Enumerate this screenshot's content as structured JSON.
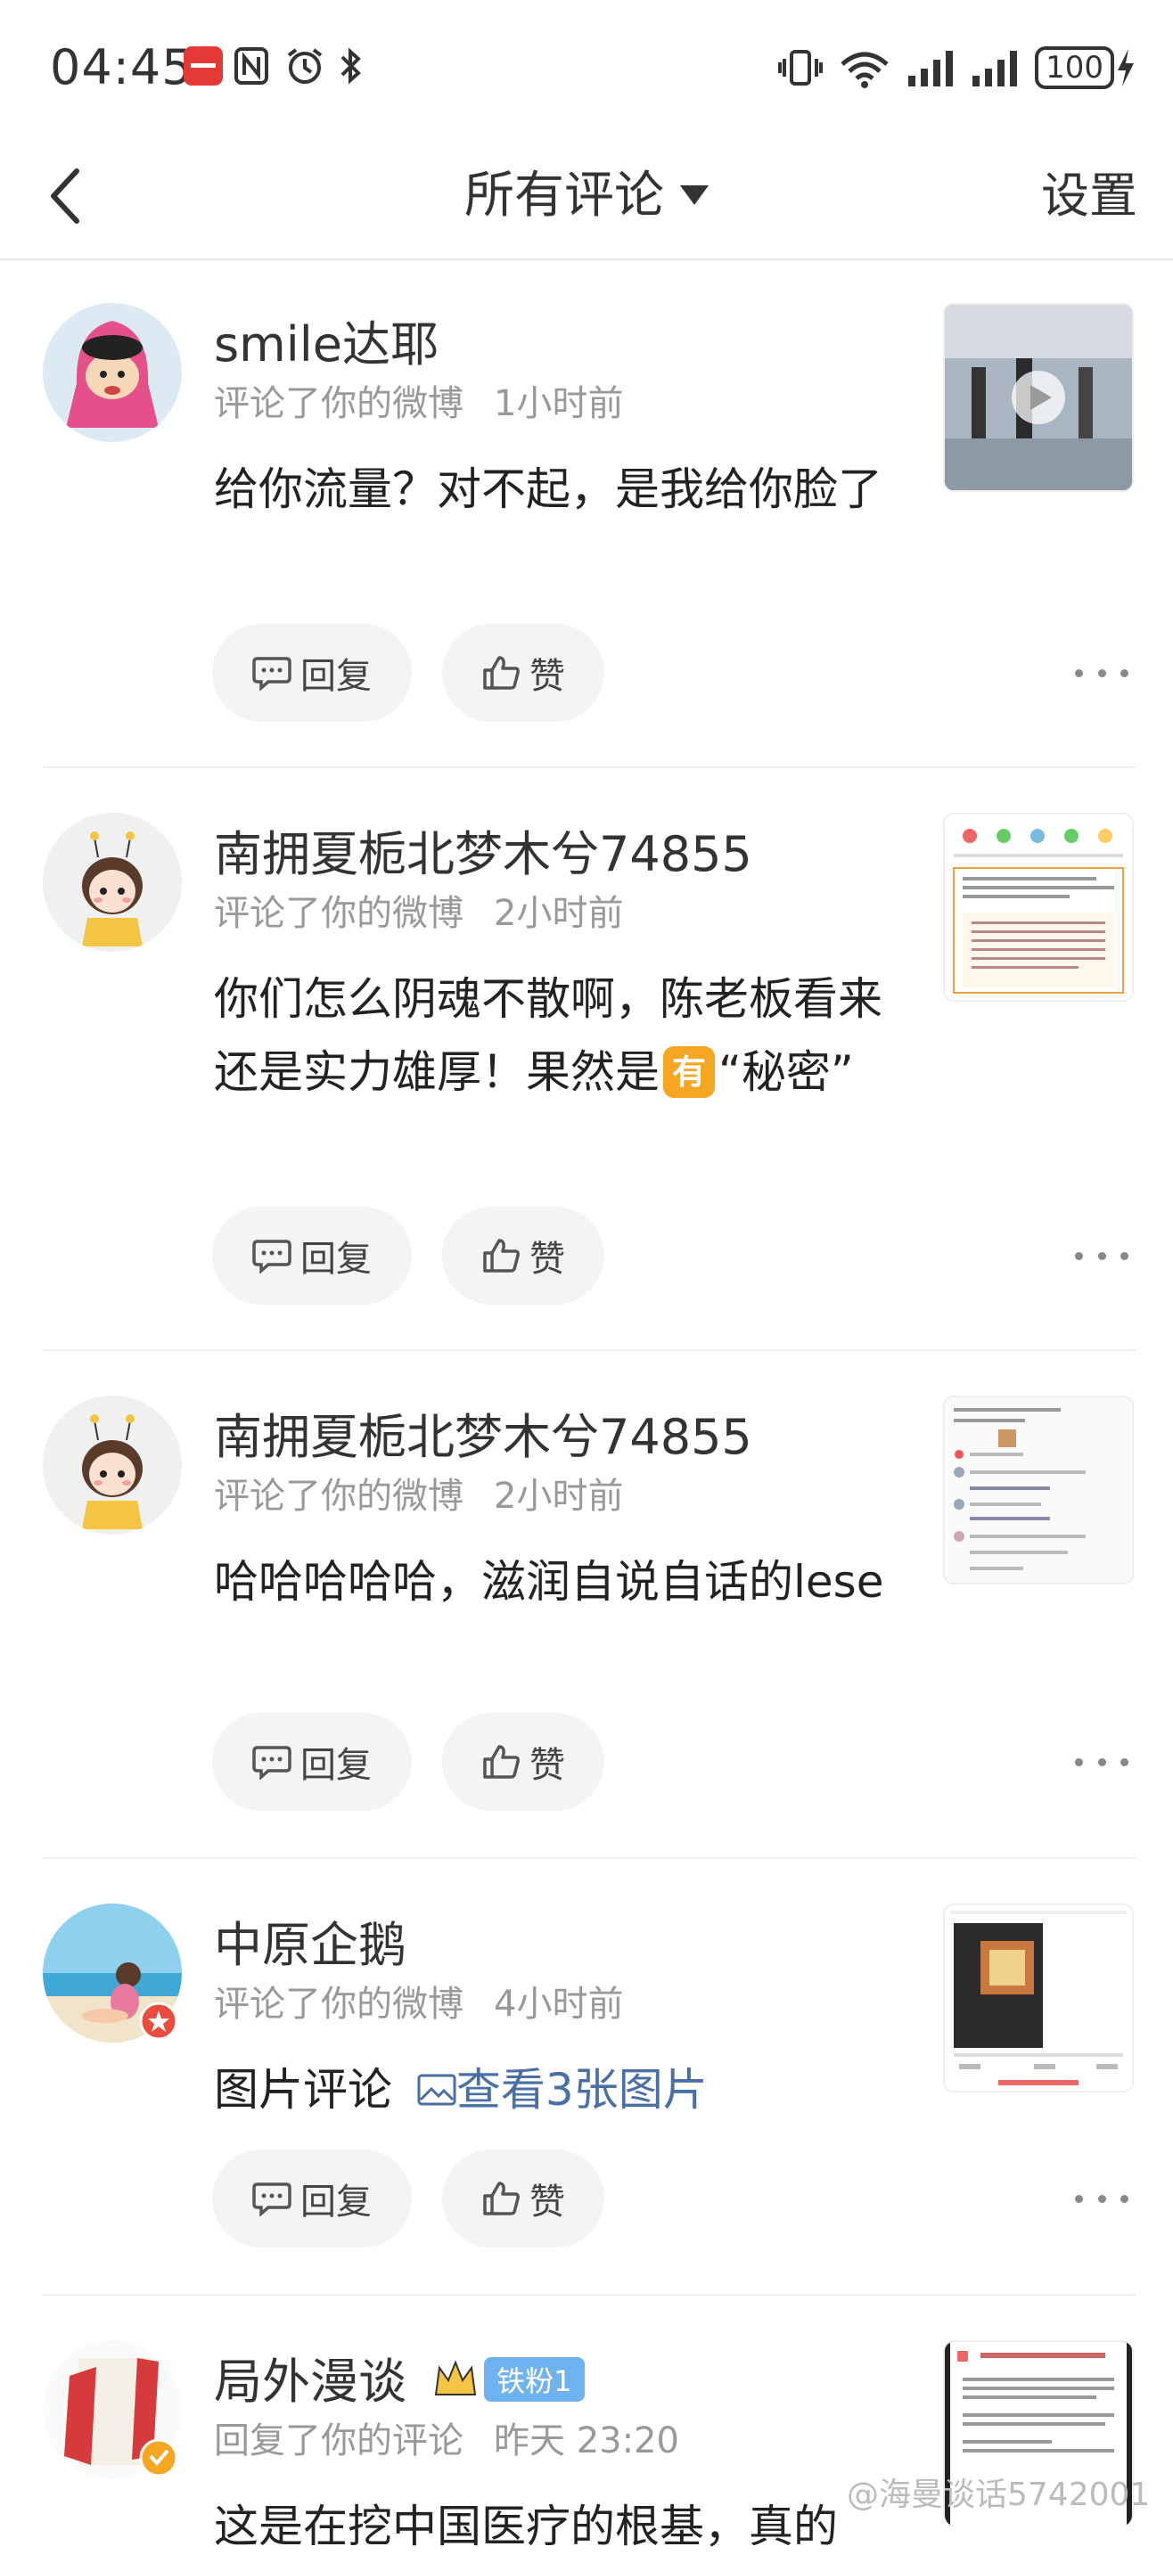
{
  "status_bar": {
    "time": "04:45",
    "battery": "100"
  },
  "nav": {
    "title": "所有评论",
    "settings_label": "设置"
  },
  "actions": {
    "reply_label": "回复",
    "like_label": "赞"
  },
  "comments": [
    {
      "name": "smile达耶",
      "action": "评论了你的微博",
      "time": "1小时前",
      "text": "给你流量？对不起，是我给你脸了"
    },
    {
      "name": "南拥夏栀北梦木兮74855",
      "action": "评论了你的微博",
      "time": "2小时前",
      "text_before": "你们怎么阴魂不散啊，陈老板看来还是实力雄厚！果然是",
      "badge": "有",
      "text_after": "“秘密”"
    },
    {
      "name": "南拥夏栀北梦木兮74855",
      "action": "评论了你的微博",
      "time": "2小时前",
      "text": "哈哈哈哈哈，滋润自说自话的lese"
    },
    {
      "name": "中原企鹅",
      "action": "评论了你的微博",
      "time": "4小时前",
      "text": "图片评论",
      "link": "查看3张图片"
    },
    {
      "name": "局外漫谈",
      "fan_badge": "铁粉1",
      "action": "回复了你的评论",
      "time": "昨天 23:20",
      "text": "这是在挖中国医疗的根基，真的"
    }
  ],
  "watermark": "@海曼谈话5742001"
}
